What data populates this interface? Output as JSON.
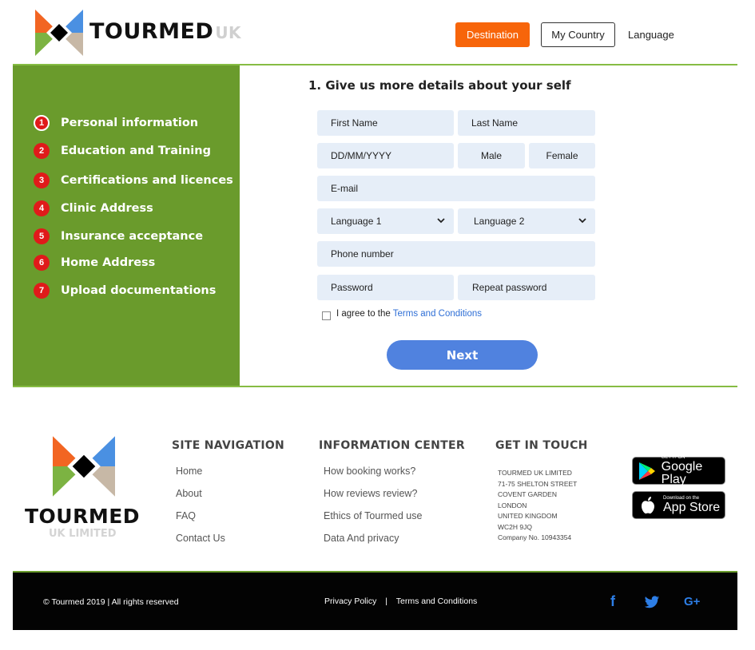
{
  "header": {
    "brand": "TOURMED",
    "brand_suffix": "UK",
    "nav": {
      "destination": "Destination",
      "my_country": "My Country",
      "language": "Language"
    }
  },
  "sidebar": {
    "steps": [
      {
        "num": "1",
        "label": "Personal information"
      },
      {
        "num": "2",
        "label": "Education and Training"
      },
      {
        "num": "3",
        "label": "Certifications and licences"
      },
      {
        "num": "4",
        "label": "Clinic Address"
      },
      {
        "num": "5",
        "label": "Insurance acceptance"
      },
      {
        "num": "6",
        "label": "Home Address"
      },
      {
        "num": "7",
        "label": "Upload documentations"
      }
    ]
  },
  "form": {
    "title": "1. Give us more details about your self",
    "first_name": "First Name",
    "last_name": "Last Name",
    "dob": "DD/MM/YYYY",
    "male": "Male",
    "female": "Female",
    "email": "E-mail",
    "language1": "Language 1",
    "language2": "Language 2",
    "phone": "Phone number",
    "password": "Password",
    "repeat_password": "Repeat password",
    "agree_prefix": "I agree to the",
    "agree_link": "Terms and Conditions",
    "next": "Next"
  },
  "footer": {
    "brand": "TOURMED",
    "brand_sub": "UK LIMITED",
    "site_nav": {
      "title": "SITE NAVIGATION",
      "items": [
        "Home",
        "About",
        "FAQ",
        "Contact Us"
      ]
    },
    "info": {
      "title": "INFORMATION CENTER",
      "items": [
        "How booking works?",
        "How reviews review?",
        "Ethics of Tourmed use",
        "Data And privacy"
      ]
    },
    "contact": {
      "title": "GET IN TOUCH",
      "lines": [
        "TOURMED UK LIMITED",
        "71-75 SHELTON STREET",
        "COVENT GARDEN",
        "LONDON",
        "UNITED KINGDOM",
        "WC2H 9JQ",
        "Company No. 10943354"
      ]
    },
    "stores": {
      "google_small": "GET IT ON",
      "google_big": "Google Play",
      "apple_small": "Download on the",
      "apple_big": "App Store"
    }
  },
  "bottom": {
    "copyright": "© Tourmed 2019   |  All rights reserved",
    "privacy": "Privacy Policy",
    "separator": "|",
    "terms": "Terms and Conditions",
    "social": {
      "facebook": "f",
      "google_plus": "G+"
    }
  }
}
